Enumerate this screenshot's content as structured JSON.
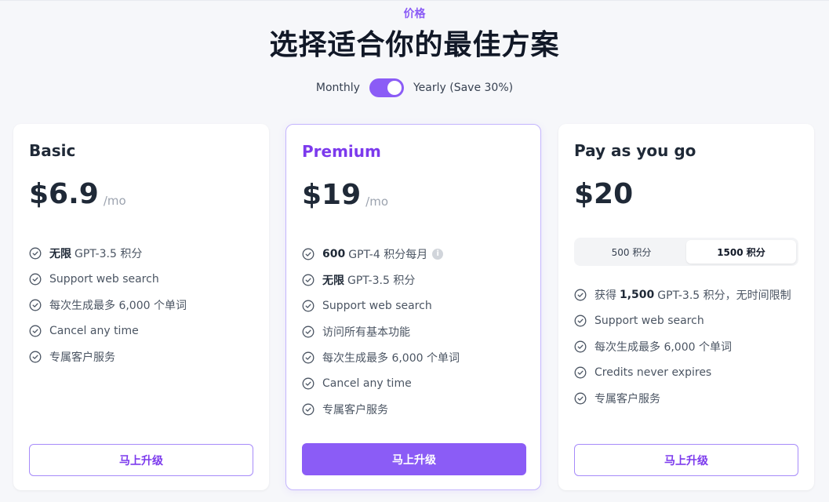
{
  "header": {
    "eyebrow": "价格",
    "title": "选择适合你的最佳方案"
  },
  "billing": {
    "monthly_label": "Monthly",
    "yearly_label": "Yearly (Save 30%)",
    "selected": "yearly"
  },
  "colors": {
    "accent": "#8b5cf6",
    "accent_dark": "#7c3aed",
    "background": "#f6f7fa"
  },
  "plans": {
    "basic": {
      "name": "Basic",
      "price": "$6.9",
      "period": "/mo",
      "features": [
        {
          "bold": "无限",
          "text": "GPT-3.5 积分"
        },
        {
          "bold": "",
          "text": "Support web search"
        },
        {
          "bold": "",
          "text": "每次生成最多 6,000 个单词"
        },
        {
          "bold": "",
          "text": "Cancel any time"
        },
        {
          "bold": "",
          "text": "专属客户服务"
        }
      ],
      "cta": "马上升级"
    },
    "premium": {
      "name": "Premium",
      "price": "$19",
      "period": "/mo",
      "features": [
        {
          "bold": "600",
          "text": "GPT-4 积分每月",
          "info_icon": "i"
        },
        {
          "bold": "无限",
          "text": "GPT-3.5 积分"
        },
        {
          "bold": "",
          "text": "Support web search"
        },
        {
          "bold": "",
          "text": "访问所有基本功能"
        },
        {
          "bold": "",
          "text": "每次生成最多 6,000 个单词"
        },
        {
          "bold": "",
          "text": "Cancel any time"
        },
        {
          "bold": "",
          "text": "专属客户服务"
        }
      ],
      "cta": "马上升级"
    },
    "payg": {
      "name": "Pay as you go",
      "price": "$20",
      "credit_options": [
        "500 积分",
        "1500 积分"
      ],
      "selected_credit": "1500 积分",
      "features": [
        {
          "prefix": "获得",
          "bold": "1,500",
          "text": "GPT-3.5 积分，无时间限制"
        },
        {
          "bold": "",
          "text": "Support web search"
        },
        {
          "bold": "",
          "text": "每次生成最多 6,000 个单词"
        },
        {
          "bold": "",
          "text": "Credits never expires"
        },
        {
          "bold": "",
          "text": "专属客户服务"
        }
      ],
      "cta": "马上升级"
    }
  }
}
